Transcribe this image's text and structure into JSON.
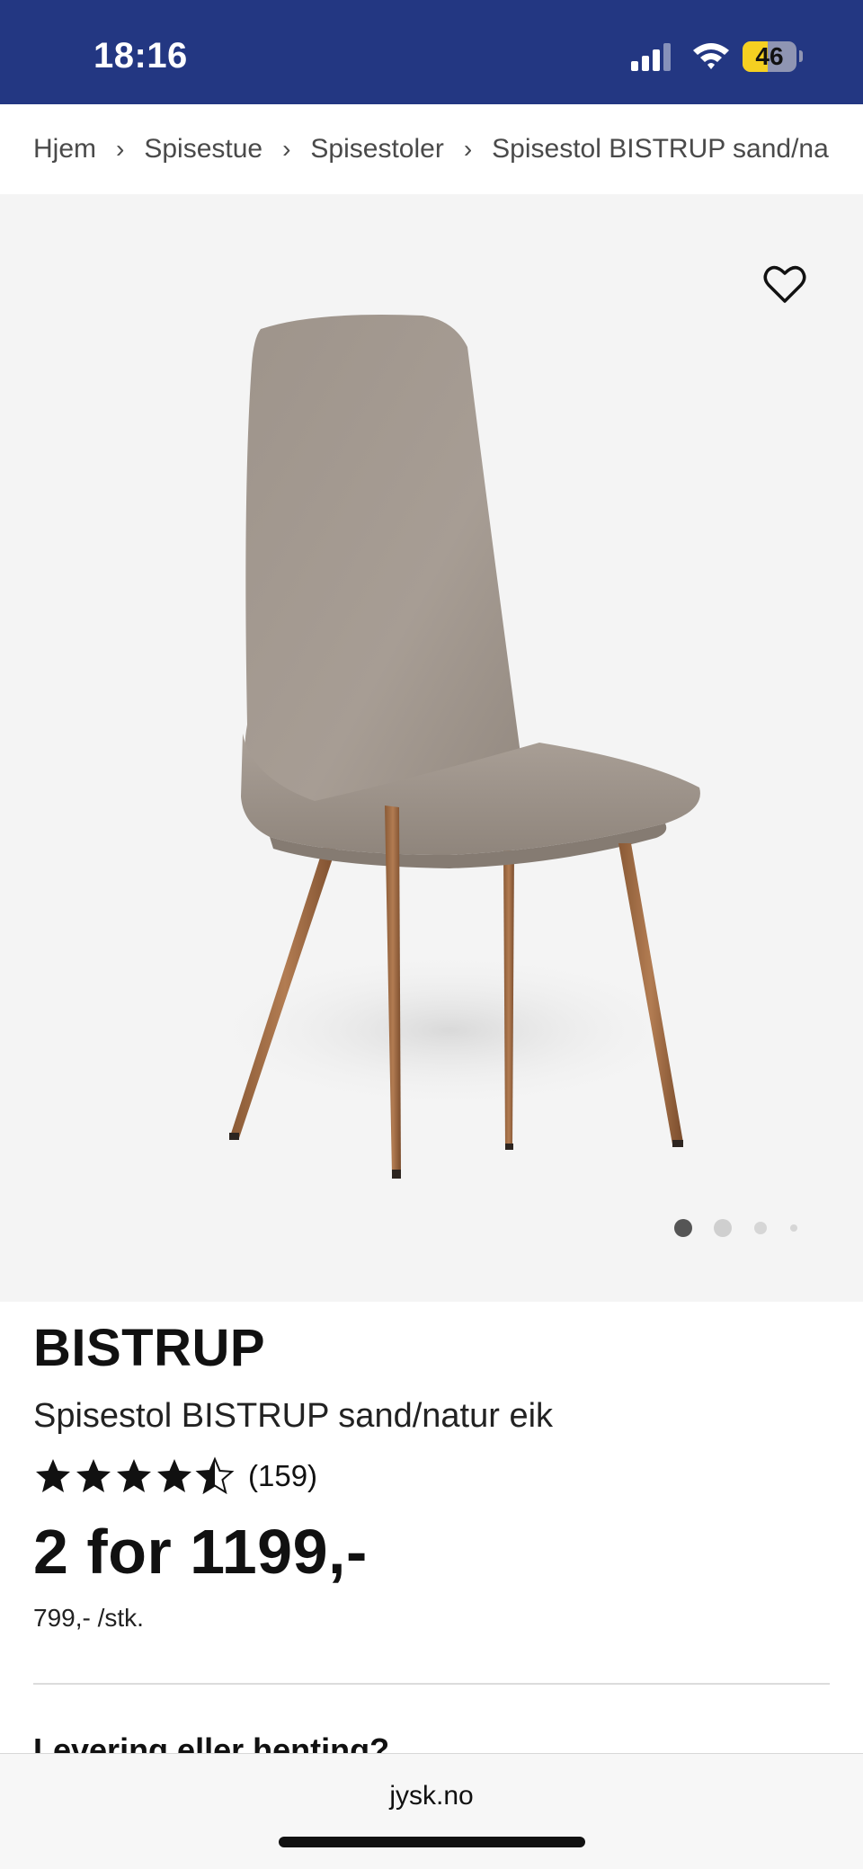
{
  "status_bar": {
    "time": "18:16",
    "battery_level": "46",
    "battery_fraction": 0.46,
    "icons": [
      "signal-icon",
      "wifi-icon",
      "battery-icon"
    ]
  },
  "breadcrumb": {
    "items": [
      "Hjem",
      "Spisestue",
      "Spisestoler",
      "Spisestol BISTRUP sand/na"
    ],
    "separator": "›"
  },
  "gallery": {
    "favorite_icon": "heart-icon",
    "slide_count": 4,
    "active_slide": 1
  },
  "product": {
    "brand": "BISTRUP",
    "name": "Spisestol BISTRUP sand/natur eik",
    "rating": 4.5,
    "rating_max": 5,
    "review_count": "(159)",
    "price": "2 for 1199,-",
    "unit_price": "799,- /stk."
  },
  "delivery": {
    "heading": "Levering eller henting?"
  },
  "browser": {
    "url": "jysk.no"
  },
  "colors": {
    "header_bg": "#233782",
    "battery_yellow": "#f5d021",
    "gallery_bg": "#f4f4f4",
    "star": "#111111"
  }
}
